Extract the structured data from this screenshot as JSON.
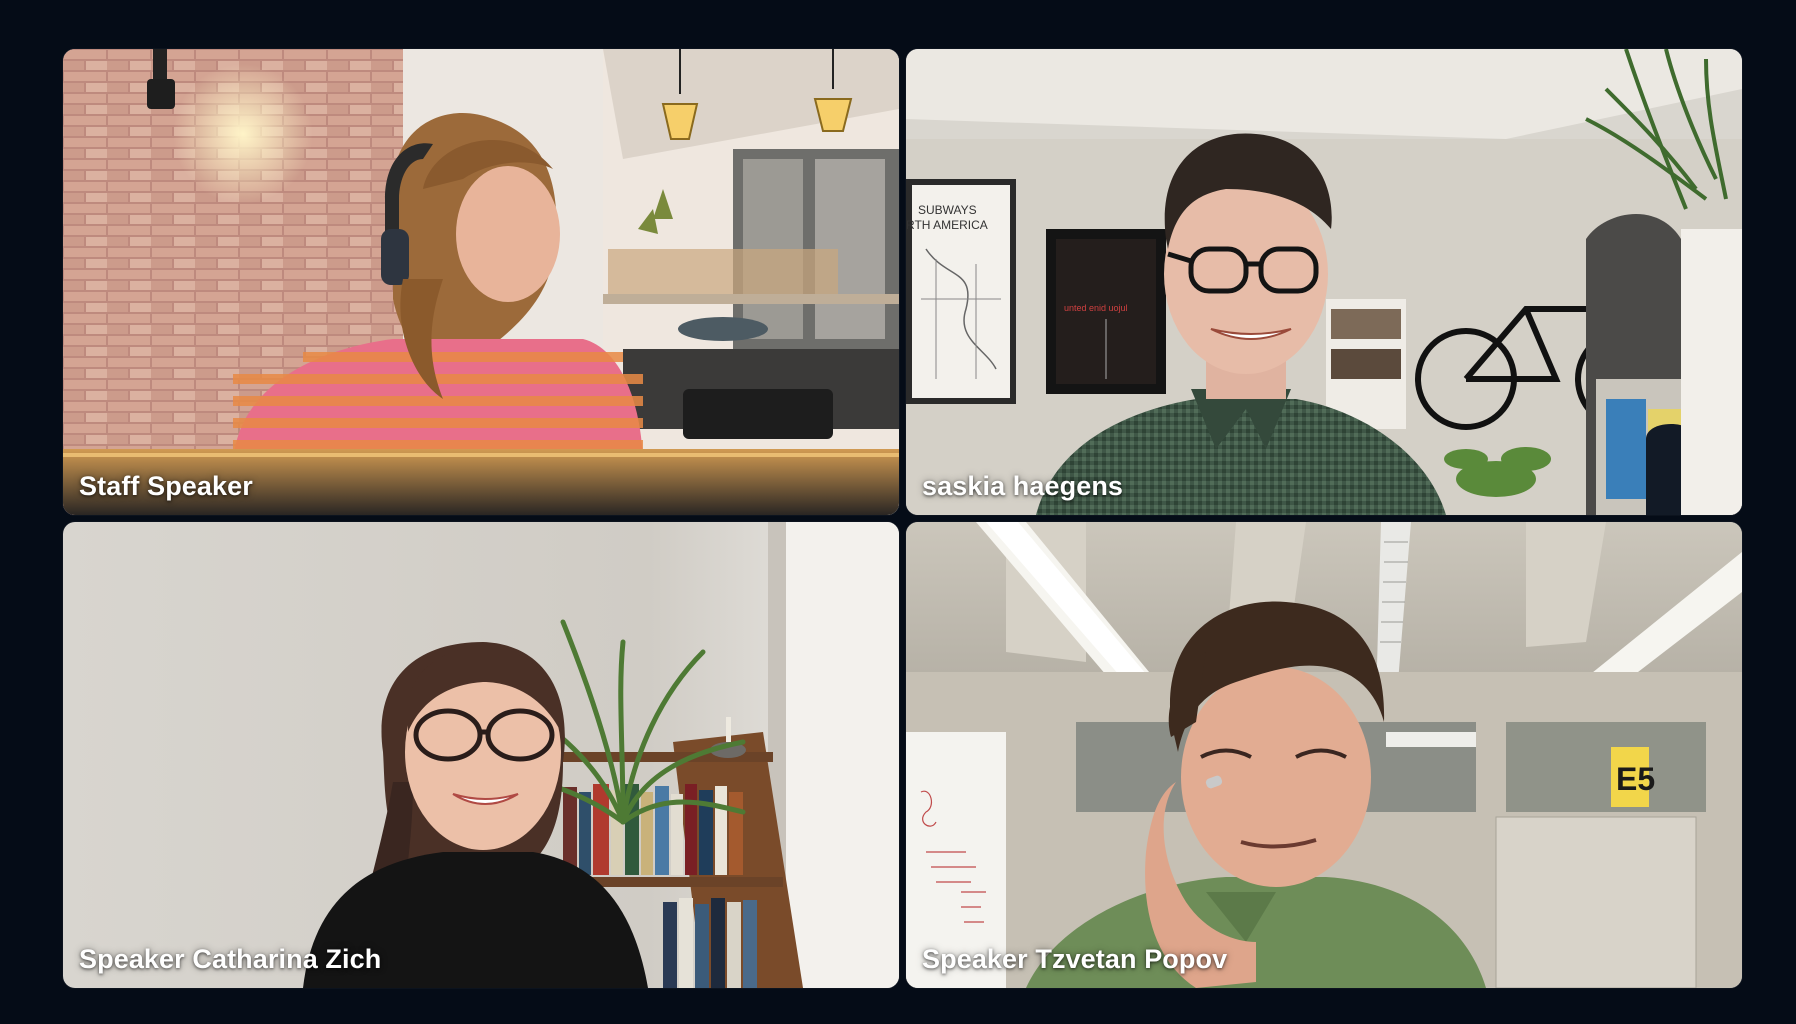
{
  "window": {
    "background": "#050c17"
  },
  "participants": [
    {
      "name": "Staff Speaker",
      "video": "participant-video",
      "accent": "#f0709a"
    },
    {
      "name": "saskia haegens",
      "video": "participant-video",
      "accent": "#3e5a48"
    },
    {
      "name": "Speaker Catharina Zich",
      "video": "participant-video",
      "accent": "#1a1a1a"
    },
    {
      "name": "Speaker Tzvetan Popov",
      "video": "participant-video",
      "accent": "#6f8f5c"
    }
  ],
  "scene_text": {
    "poster_left": "SUBWAYS\nRTH AMERICA",
    "poster_dark": "unted enid uojul",
    "room_sign": "E5"
  }
}
